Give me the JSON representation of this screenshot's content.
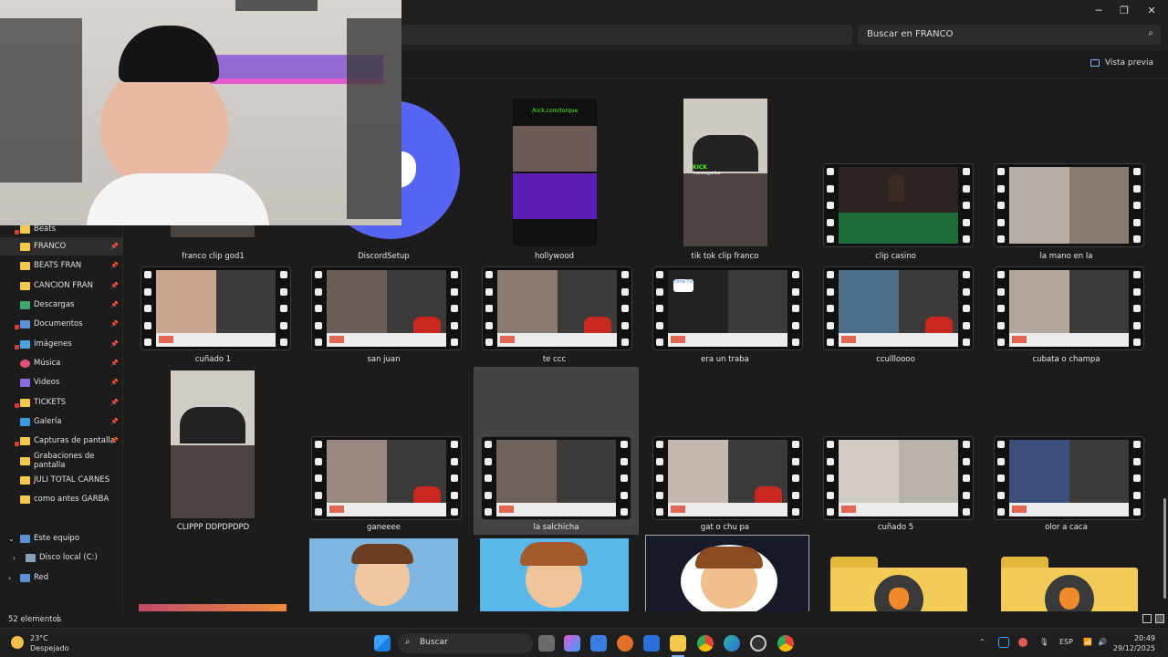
{
  "window": {
    "minimize_icon": "minimize-icon",
    "maximize_icon": "restore-icon",
    "close_icon": "close-icon"
  },
  "search": {
    "placeholder": "Buscar en FRANCO"
  },
  "command_bar": {
    "preview_label": "Vista previa"
  },
  "sidebar": {
    "items": [
      {
        "label": "Beats",
        "pinned": false,
        "error": true
      },
      {
        "label": "FRANCO",
        "pinned": true,
        "active": true
      },
      {
        "label": "BEATS FRAN",
        "pinned": true
      },
      {
        "label": "CANCION FRAN",
        "pinned": true
      },
      {
        "label": "Descargas",
        "pinned": true,
        "icon": "download-icon"
      },
      {
        "label": "Documentos",
        "pinned": true,
        "error": true,
        "icon": "documents-icon"
      },
      {
        "label": "Imágenes",
        "pinned": true,
        "error": true,
        "icon": "pictures-icon"
      },
      {
        "label": "Música",
        "pinned": true,
        "icon": "music-icon"
      },
      {
        "label": "Videos",
        "pinned": true,
        "icon": "videos-icon"
      },
      {
        "label": "TICKETS",
        "pinned": true,
        "error": true
      },
      {
        "label": "Galería",
        "pinned": true,
        "icon": "gallery-icon"
      },
      {
        "label": "Capturas de pantalla",
        "pinned": true,
        "error": true
      },
      {
        "label": "Grabaciones de pantalla",
        "pinned": false
      },
      {
        "label": "JULI TOTAL CARNES",
        "pinned": false
      },
      {
        "label": "como antes GARBA",
        "pinned": false
      }
    ],
    "this_pc": "Este equipo",
    "local_disk": "Disco local (C:)",
    "network": "Red"
  },
  "files": {
    "row1": [
      "franco clip god1",
      "DiscordSetup",
      "hollywood",
      "tik tok clip franco",
      "clip casino",
      "la mano en la"
    ],
    "row2": [
      "cuñado 1",
      "san juan",
      "te ccc",
      "era un traba",
      "ccullloooo",
      "cubata o champa"
    ],
    "row3": [
      "CLIPPP DDPDPDPD",
      "ganeeee",
      "la salchicha",
      "gat o chu pa",
      "cuñado 5",
      "olor a caca"
    ]
  },
  "thumb_text": {
    "kick_url": "/kick.com/torque",
    "kick": "KICK",
    "kick_user": "francogarba",
    "ome": "Ome TV"
  },
  "status": {
    "count": "52 elementos"
  },
  "taskbar": {
    "temp": "23°C",
    "weather": "Despejado",
    "search": "Buscar",
    "lang": "ESP",
    "time": "20:49",
    "date": "29/12/2025"
  },
  "colors": {
    "accent": "#f2c94c",
    "discord": "#5865f2",
    "kick_green": "#53fc18",
    "error_badge": "#d63c3c"
  }
}
